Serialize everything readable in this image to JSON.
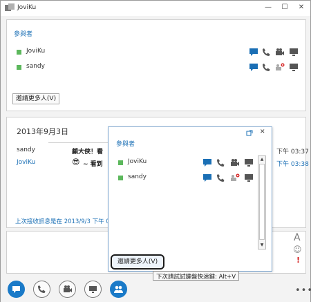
{
  "window": {
    "title": "JoviKu",
    "minimize": "—",
    "maximize": "☐",
    "close": "✕"
  },
  "participants": {
    "heading": "參與者",
    "people": [
      {
        "name": "JoviKu",
        "status_color": "#5cb85c"
      },
      {
        "name": "sandy",
        "status_color": "#5cb85c"
      }
    ],
    "invite_button": "邀請更多人(V)"
  },
  "conversation": {
    "date": "2013年9月3日",
    "messages": [
      {
        "sender": "sandy",
        "text": "顧大俠！看",
        "time": "下午 03:37",
        "sender_color": "#333333",
        "time_color": "#333333"
      },
      {
        "sender": "JoviKu",
        "emoji": "😎",
        "text": "~ 看到",
        "time": "下午 03:38",
        "sender_color": "#1a6fb5",
        "time_color": "#1a6fb5"
      }
    ],
    "last_received": "上次接收訊息是在 2013/9/3 下午 0"
  },
  "flyout": {
    "heading": "參與者",
    "people": [
      {
        "name": "JoviKu"
      },
      {
        "name": "sandy"
      }
    ],
    "invite_button": "邀請更多人(V)",
    "tooltip": "下次請試試鍵盤快速鍵: Alt+V",
    "close": "✕"
  },
  "compose_side": {
    "font_glyph": "A",
    "emoticon_glyph": "☺",
    "priority_glyph": "!"
  },
  "bottom_bar": {
    "buttons": [
      {
        "name": "im-button",
        "icon": "speech-bubble-icon"
      },
      {
        "name": "call-button",
        "icon": "phone-icon"
      },
      {
        "name": "video-button",
        "icon": "video-camera-icon"
      },
      {
        "name": "present-button",
        "icon": "monitor-icon"
      },
      {
        "name": "participants-button",
        "icon": "people-icon"
      }
    ],
    "more": "•••"
  },
  "colors": {
    "accent": "#1a7ac8",
    "link": "#1a6fb5",
    "presence_available": "#5cb85c",
    "alert": "#d42020"
  }
}
